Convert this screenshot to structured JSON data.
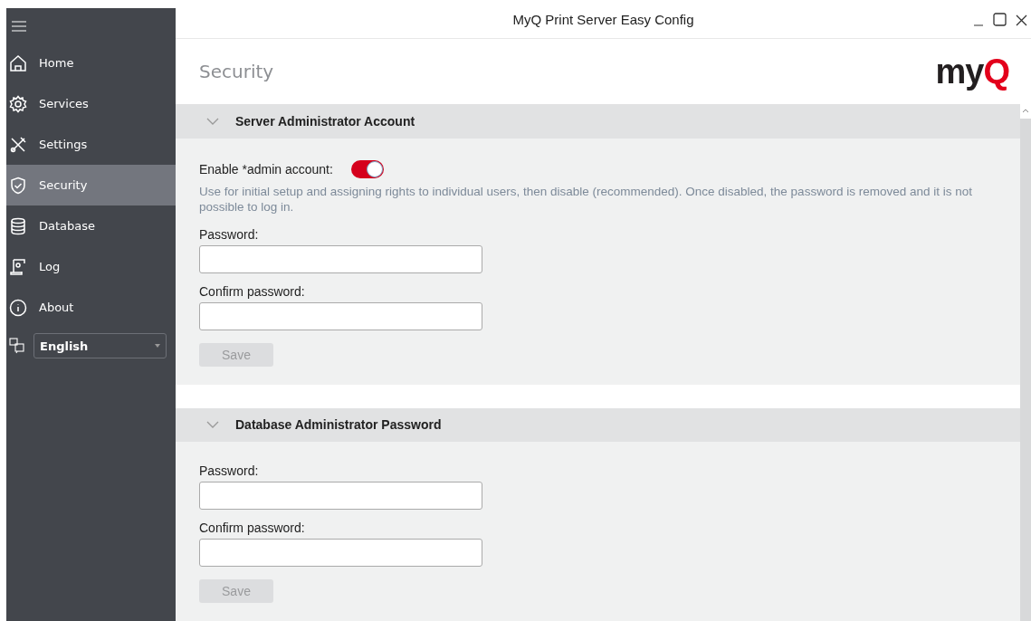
{
  "window": {
    "title": "MyQ Print Server Easy Config"
  },
  "sidebar": {
    "items": [
      {
        "label": "Home",
        "selected": false
      },
      {
        "label": "Services",
        "selected": false
      },
      {
        "label": "Settings",
        "selected": false
      },
      {
        "label": "Security",
        "selected": true
      },
      {
        "label": "Database",
        "selected": false
      },
      {
        "label": "Log",
        "selected": false
      },
      {
        "label": "About",
        "selected": false
      }
    ],
    "language": {
      "value": "English"
    }
  },
  "page": {
    "title": "Security",
    "logo": [
      {
        "text": "my",
        "color": "#231f20"
      },
      {
        "text": "Q",
        "color": "#e3001b"
      }
    ]
  },
  "sections": [
    {
      "title": "Server Administrator Account",
      "expanded": true,
      "toggle": {
        "label": "Enable *admin account:",
        "on": true
      },
      "hint": "Use for initial setup and assigning rights to individual users, then disable (recommended). Once disabled, the password is removed and it is not possible to log in.",
      "fields": [
        {
          "label": "Password:"
        },
        {
          "label": "Confirm password:"
        }
      ],
      "save": {
        "label": "Save",
        "disabled": true
      }
    },
    {
      "title": "Database Administrator Password",
      "expanded": true,
      "fields": [
        {
          "label": "Password:"
        },
        {
          "label": "Confirm password:"
        }
      ],
      "save": {
        "label": "Save",
        "disabled": true
      }
    }
  ]
}
